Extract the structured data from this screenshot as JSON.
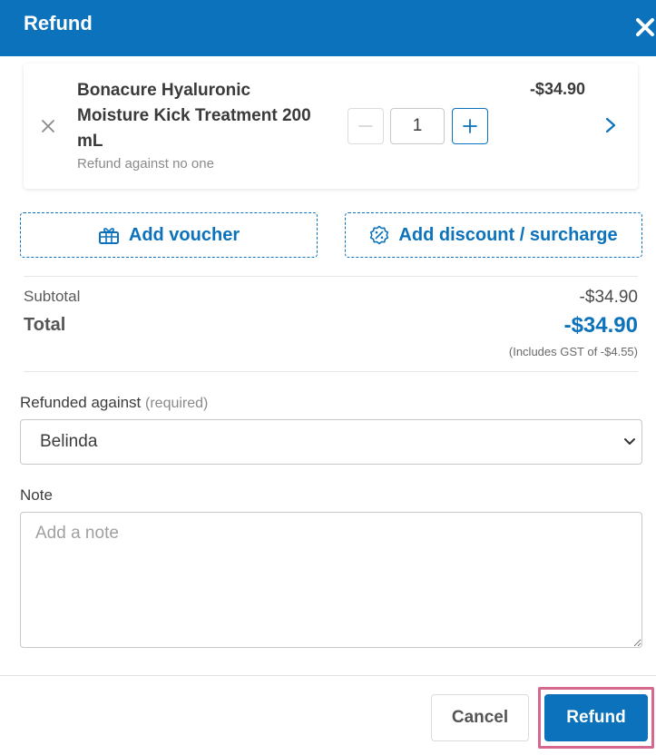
{
  "header": {
    "title": "Refund"
  },
  "item": {
    "name": "Bonacure Hyaluronic Moisture Kick Treatment 200 mL",
    "subtitle": "Refund against no one",
    "quantity": "1",
    "price": "-$34.90"
  },
  "actions": {
    "voucher_label": "Add voucher",
    "discount_label": "Add discount / surcharge"
  },
  "totals": {
    "subtotal_label": "Subtotal",
    "subtotal_value": "-$34.90",
    "total_label": "Total",
    "total_value": "-$34.90",
    "gst_note": "(Includes GST of -$4.55)"
  },
  "refunded_against": {
    "label": "Refunded against",
    "required": "(required)",
    "selected": "Belinda"
  },
  "note": {
    "label": "Note",
    "placeholder": "Add a note"
  },
  "footer": {
    "cancel_label": "Cancel",
    "refund_label": "Refund"
  },
  "colors": {
    "primary": "#0c72bb",
    "highlight": "#d6688f"
  }
}
